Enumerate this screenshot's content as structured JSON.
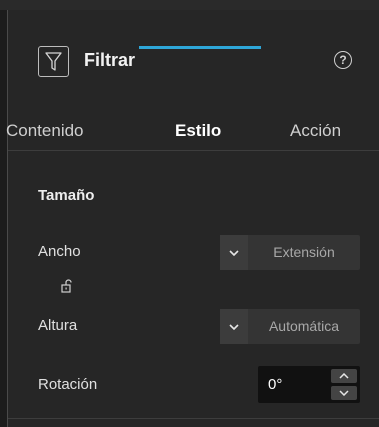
{
  "header": {
    "title": "Filtrar",
    "icon": "filter-icon",
    "help_icon": "help-icon",
    "help_glyph": "?"
  },
  "tabs": [
    {
      "label": "Contenido",
      "active": false
    },
    {
      "label": "Estilo",
      "active": true
    },
    {
      "label": "Acción",
      "active": false
    }
  ],
  "style": {
    "section_title": "Tamaño",
    "width": {
      "label": "Ancho",
      "value": "Extensión"
    },
    "height": {
      "label": "Altura",
      "value": "Automática"
    },
    "rotation": {
      "label": "Rotación",
      "value": "0°"
    },
    "lock_icon": "unlock-icon"
  },
  "colors": {
    "accent": "#2ea6d8",
    "background": "#262626"
  }
}
